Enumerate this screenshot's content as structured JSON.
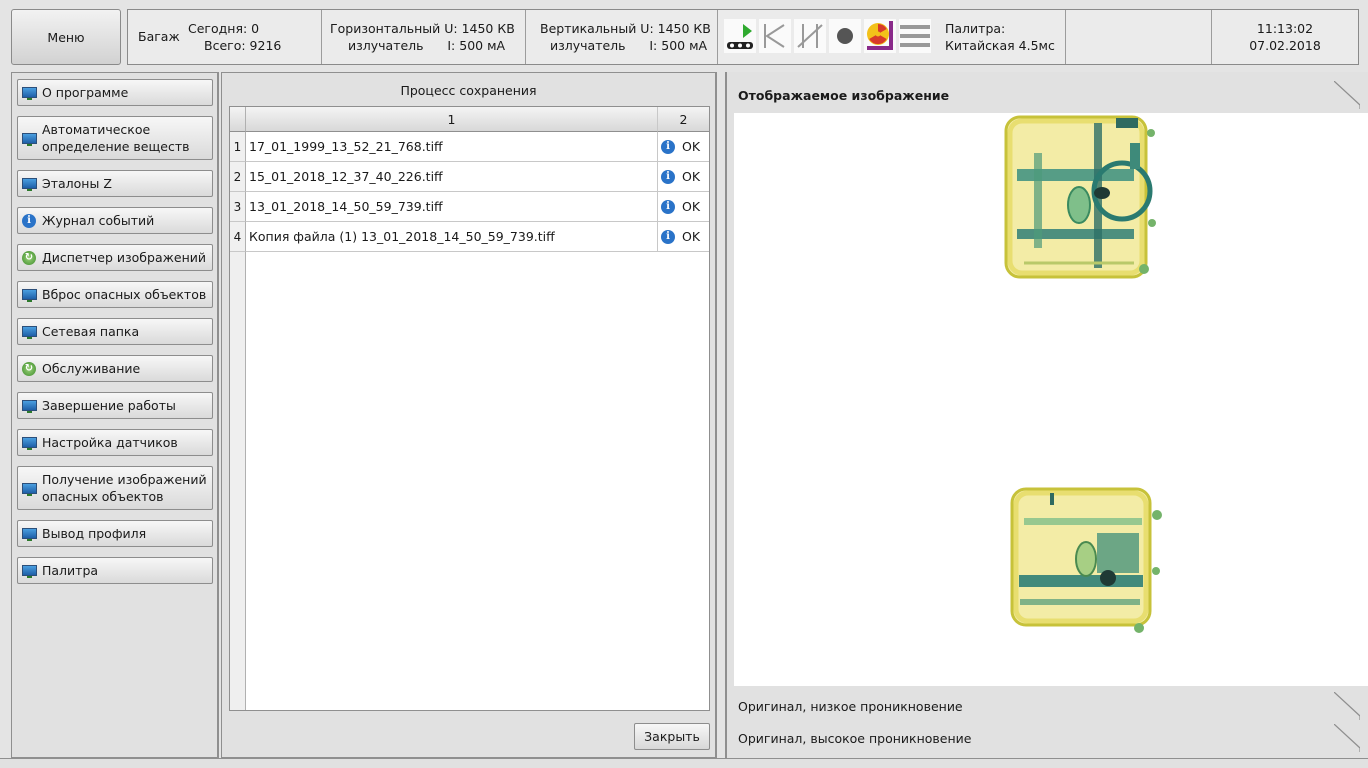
{
  "menu_label": "Меню",
  "status": {
    "baggage_label": "Багаж",
    "today": "Сегодня: 0",
    "total": "Всего: 9216",
    "horizontal_line1": "Горизонтальный U: 1450 КВ",
    "horizontal_line2": "излучатель      I: 500 мА",
    "vertical_line1": "Вертикальный U: 1450 КВ",
    "vertical_line2": "излучатель      I: 500 мА",
    "palette_label": "Палитра:",
    "palette_value": "Китайская 4.5мс",
    "time": "11:13:02",
    "date": "07.02.2018"
  },
  "sidebar": {
    "items": [
      {
        "label": "О программе",
        "icon": "monitor-icon"
      },
      {
        "label": "Автоматическое определение веществ",
        "icon": "monitor-icon"
      },
      {
        "label": "Эталоны Z",
        "icon": "monitor-icon"
      },
      {
        "label": "Журнал событий",
        "icon": "info-icon"
      },
      {
        "label": "Диспетчер изображений",
        "icon": "refresh-icon"
      },
      {
        "label": "Вброс опасных объектов",
        "icon": "monitor-icon"
      },
      {
        "label": "Сетевая папка",
        "icon": "monitor-icon"
      },
      {
        "label": "Обслуживание",
        "icon": "refresh-icon"
      },
      {
        "label": "Завершение работы",
        "icon": "monitor-icon"
      },
      {
        "label": "Настройка датчиков",
        "icon": "monitor-icon"
      },
      {
        "label": "Получение изображений опасных объектов",
        "icon": "monitor-icon"
      },
      {
        "label": "Вывод профиля",
        "icon": "monitor-icon"
      },
      {
        "label": "Палитра",
        "icon": "monitor-icon"
      }
    ]
  },
  "save_process": {
    "title": "Процесс сохранения",
    "columns": [
      "1",
      "2"
    ],
    "rows": [
      {
        "num": "1",
        "file": "17_01_1999_13_52_21_768.tiff",
        "status": "OK"
      },
      {
        "num": "2",
        "file": "15_01_2018_12_37_40_226.tiff",
        "status": "OK"
      },
      {
        "num": "3",
        "file": "13_01_2018_14_50_59_739.tiff",
        "status": "OK"
      },
      {
        "num": "4",
        "file": "Копия файла (1) 13_01_2018_14_50_59_739.tiff",
        "status": "OK"
      }
    ],
    "close_label": "Закрыть"
  },
  "image_panel": {
    "displayed_title": "Отображаемое изображение",
    "low_penetration": "Оригинал, низкое проникновение",
    "high_penetration": "Оригинал, высокое проникновение"
  }
}
